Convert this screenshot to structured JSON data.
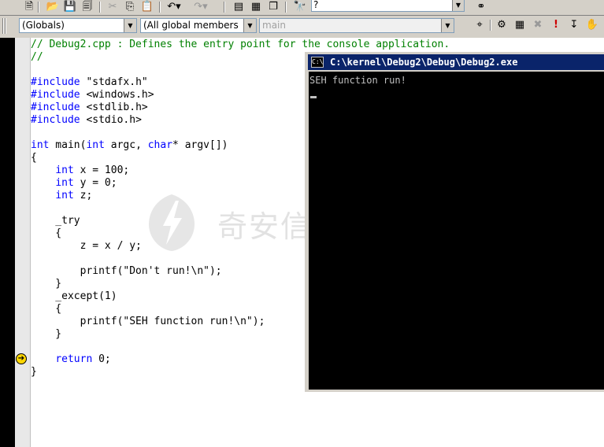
{
  "find": {
    "value": "?"
  },
  "combos": {
    "scope": "(Globals)",
    "members": "(All global members",
    "function": "main"
  },
  "code": [
    {
      "parts": [
        {
          "t": "// Debug2.cpp : Defines the entry point for the console application.",
          "c": "cm"
        }
      ]
    },
    {
      "parts": [
        {
          "t": "//",
          "c": "cm"
        }
      ]
    },
    {
      "parts": []
    },
    {
      "parts": [
        {
          "t": "#include",
          "c": "kw"
        },
        {
          "t": " \"stdafx.h\"",
          "c": ""
        }
      ]
    },
    {
      "parts": [
        {
          "t": "#include",
          "c": "kw"
        },
        {
          "t": " <windows.h>",
          "c": ""
        }
      ]
    },
    {
      "parts": [
        {
          "t": "#include",
          "c": "kw"
        },
        {
          "t": " <stdlib.h>",
          "c": ""
        }
      ]
    },
    {
      "parts": [
        {
          "t": "#include",
          "c": "kw"
        },
        {
          "t": " <stdio.h>",
          "c": ""
        }
      ]
    },
    {
      "parts": []
    },
    {
      "parts": [
        {
          "t": "int",
          "c": "kw"
        },
        {
          "t": " main(",
          "c": ""
        },
        {
          "t": "int",
          "c": "kw"
        },
        {
          "t": " argc, ",
          "c": ""
        },
        {
          "t": "char",
          "c": "kw"
        },
        {
          "t": "* argv[])",
          "c": ""
        }
      ]
    },
    {
      "parts": [
        {
          "t": "{",
          "c": ""
        }
      ]
    },
    {
      "parts": [
        {
          "t": "    ",
          "c": ""
        },
        {
          "t": "int",
          "c": "kw"
        },
        {
          "t": " x = 100;",
          "c": ""
        }
      ]
    },
    {
      "parts": [
        {
          "t": "    ",
          "c": ""
        },
        {
          "t": "int",
          "c": "kw"
        },
        {
          "t": " y = 0;",
          "c": ""
        }
      ]
    },
    {
      "parts": [
        {
          "t": "    ",
          "c": ""
        },
        {
          "t": "int",
          "c": "kw"
        },
        {
          "t": " z;",
          "c": ""
        }
      ]
    },
    {
      "parts": []
    },
    {
      "parts": [
        {
          "t": "    _try",
          "c": ""
        }
      ]
    },
    {
      "parts": [
        {
          "t": "    {",
          "c": ""
        }
      ]
    },
    {
      "parts": [
        {
          "t": "        z = x / y;",
          "c": ""
        }
      ]
    },
    {
      "parts": []
    },
    {
      "parts": [
        {
          "t": "        printf(\"Don't run!\\n\");",
          "c": ""
        }
      ]
    },
    {
      "parts": [
        {
          "t": "    }",
          "c": ""
        }
      ]
    },
    {
      "parts": [
        {
          "t": "    _except(1)",
          "c": ""
        }
      ]
    },
    {
      "parts": [
        {
          "t": "    {",
          "c": ""
        }
      ]
    },
    {
      "parts": [
        {
          "t": "        printf(\"SEH function run!\\n\");",
          "c": ""
        }
      ]
    },
    {
      "parts": [
        {
          "t": "    }",
          "c": ""
        }
      ]
    },
    {
      "parts": []
    },
    {
      "parts": [
        {
          "t": "    ",
          "c": ""
        },
        {
          "t": "return",
          "c": "kw"
        },
        {
          "t": " 0;",
          "c": ""
        }
      ]
    },
    {
      "parts": [
        {
          "t": "}",
          "c": ""
        }
      ]
    }
  ],
  "console": {
    "title": "C:\\kernel\\Debug2\\Debug\\Debug2.exe",
    "output": "SEH function run!"
  },
  "watermark": {
    "text": "奇安信攻防社区"
  },
  "icons": [
    "doc-icon",
    "open-icon",
    "save-icon",
    "save-all-icon",
    "cut-icon",
    "copy-icon",
    "paste-icon",
    "undo-icon",
    "redo-icon",
    "workspace-icon",
    "output-icon",
    "window-list-icon",
    "find-in-files-icon",
    "binoculars-icon",
    "wizard-icon",
    "class-wizard-icon",
    "compile-icon",
    "build-icon",
    "stop-build-icon",
    "execute-icon",
    "insert-breakpoint-icon",
    "go-icon"
  ]
}
